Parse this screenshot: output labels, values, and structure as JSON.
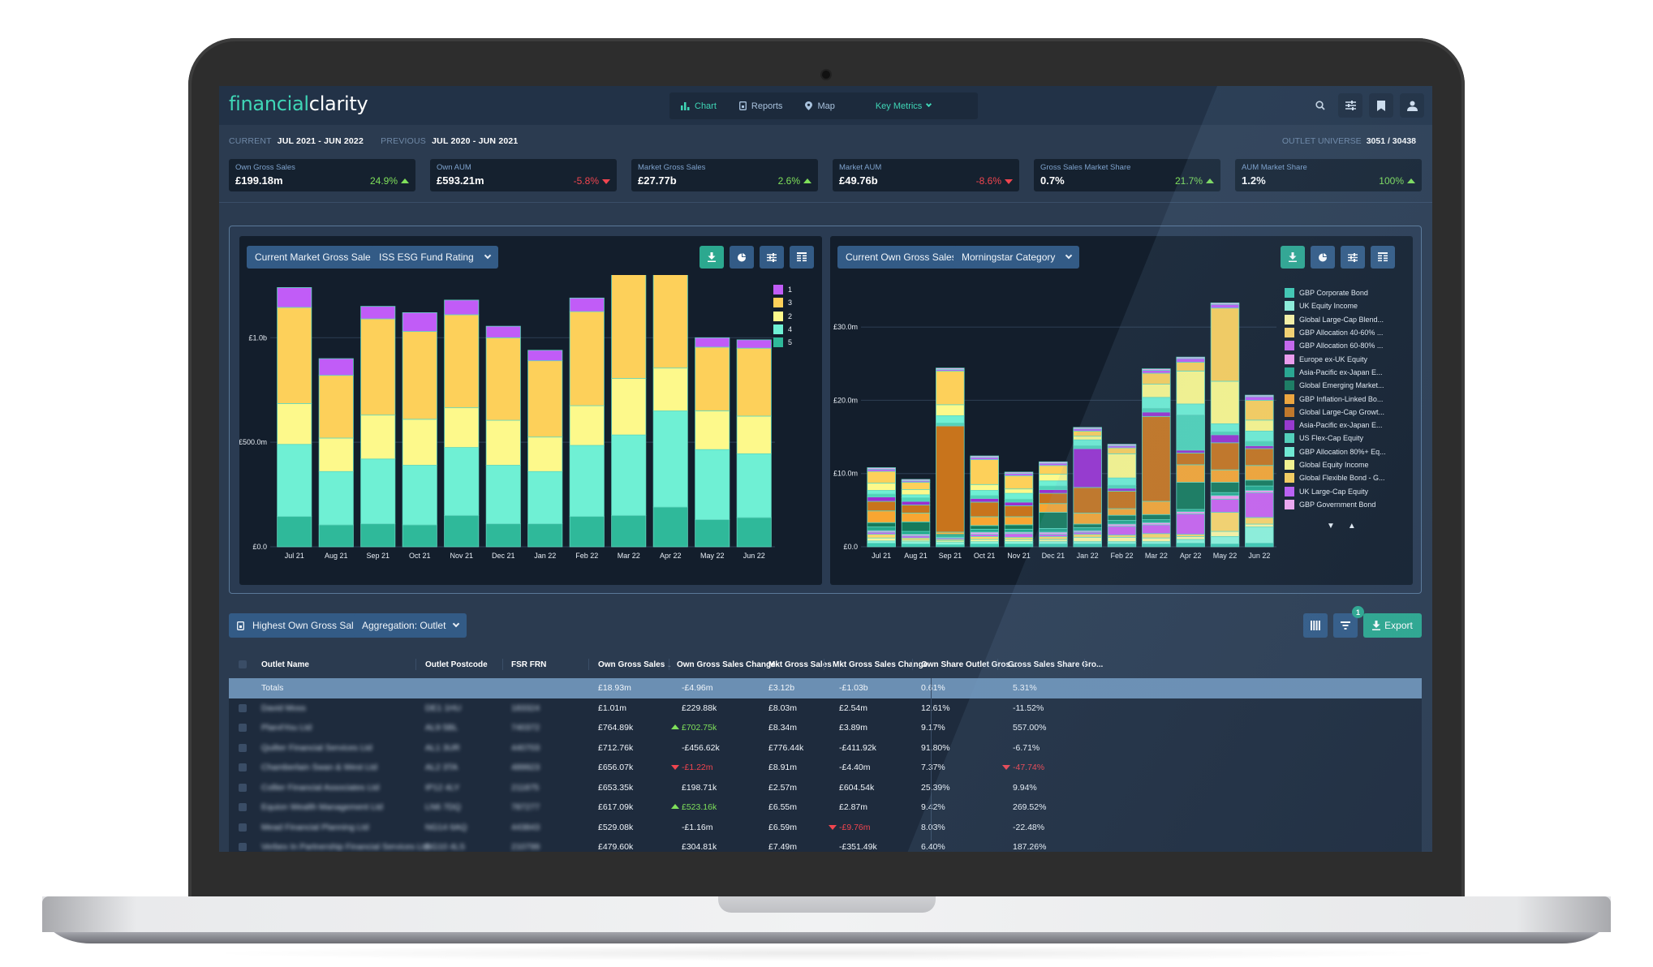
{
  "app": {
    "logo_part1": "financial",
    "logo_part2": "clarity"
  },
  "nav": {
    "items": [
      {
        "label": "Chart",
        "icon": "bar-chart-icon",
        "active": true
      },
      {
        "label": "Reports",
        "icon": "document-icon",
        "active": false
      },
      {
        "label": "Map",
        "icon": "map-pin-icon",
        "active": false
      }
    ],
    "key_metrics_label": "Key Metrics",
    "right_icons": [
      "search-icon",
      "sliders-icon",
      "bookmark-icon",
      "user-icon"
    ]
  },
  "period": {
    "current_label": "CURRENT",
    "current_value": "JUL 2021 - JUN 2022",
    "previous_label": "PREVIOUS",
    "previous_value": "JUL 2020 - JUN 2021",
    "universe_label": "OUTLET UNIVERSE",
    "universe_value": "3051 / 30438"
  },
  "kpis": [
    {
      "label": "Own Gross Sales",
      "value": "£199.18m",
      "change": "24.9%",
      "direction": "up"
    },
    {
      "label": "Own AUM",
      "value": "£593.21m",
      "change": "-5.8%",
      "direction": "down"
    },
    {
      "label": "Market Gross Sales",
      "value": "£27.77b",
      "change": "2.6%",
      "direction": "up"
    },
    {
      "label": "Market AUM",
      "value": "£49.76b",
      "change": "-8.6%",
      "direction": "down"
    },
    {
      "label": "Gross Sales Market Share",
      "value": "0.7%",
      "change": "21.7%",
      "direction": "up"
    },
    {
      "label": "AUM Market Share",
      "value": "1.2%",
      "change": "100%",
      "direction": "up"
    }
  ],
  "left_panel": {
    "metric_dropdown": "Current Market Gross Sales",
    "group_dropdown": "ISS ESG Fund Rating",
    "tools": [
      "download-icon",
      "pie-chart-icon",
      "sliders-icon",
      "table-icon"
    ]
  },
  "right_panel": {
    "metric_dropdown": "Current Own Gross Sales",
    "group_dropdown": "Morningstar Category",
    "tools": [
      "download-icon",
      "pie-chart-icon",
      "sliders-icon",
      "table-icon"
    ],
    "legend_scroll": {
      "down": "▼",
      "up": "▲"
    }
  },
  "chart_data": [
    {
      "type": "bar",
      "stacked": true,
      "title": "Current Market Gross Sales by ISS ESG Fund Rating",
      "xlabel": "",
      "ylabel": "",
      "ylim": [
        0,
        1300
      ],
      "y_unit": "£m",
      "yticks": [
        {
          "value": 0,
          "label": "£0.0"
        },
        {
          "value": 500,
          "label": "£500.0m"
        },
        {
          "value": 1000,
          "label": "£1.0b"
        }
      ],
      "categories": [
        "Jul 21",
        "Aug 21",
        "Sep 21",
        "Oct 21",
        "Nov 21",
        "Dec 21",
        "Jan 22",
        "Feb 22",
        "Mar 22",
        "Apr 22",
        "May 22",
        "Jun 22"
      ],
      "legend_position": "right",
      "series": [
        {
          "name": "5",
          "color": "#2fb99a",
          "values": [
            145,
            105,
            110,
            105,
            150,
            110,
            110,
            145,
            150,
            190,
            130,
            140
          ]
        },
        {
          "name": "4",
          "color": "#6ff0d4",
          "values": [
            345,
            255,
            310,
            285,
            325,
            280,
            250,
            340,
            385,
            460,
            335,
            305
          ]
        },
        {
          "name": "2",
          "color": "#fdf98b",
          "values": [
            195,
            160,
            210,
            220,
            190,
            215,
            165,
            190,
            270,
            205,
            185,
            180
          ]
        },
        {
          "name": "3",
          "color": "#fdd05a",
          "values": [
            460,
            300,
            460,
            420,
            445,
            395,
            365,
            450,
            600,
            505,
            305,
            325
          ]
        },
        {
          "name": "1",
          "color": "#c15cf7",
          "values": [
            95,
            80,
            60,
            90,
            70,
            55,
            50,
            65,
            75,
            70,
            45,
            40
          ]
        }
      ]
    },
    {
      "type": "bar",
      "stacked": true,
      "title": "Current Own Gross Sales by Morningstar Category",
      "xlabel": "",
      "ylabel": "",
      "ylim": [
        0,
        36
      ],
      "y_unit": "£m",
      "yticks": [
        {
          "value": 0,
          "label": "£0.0"
        },
        {
          "value": 10,
          "label": "£10.0m"
        },
        {
          "value": 20,
          "label": "£20.0m"
        },
        {
          "value": 30,
          "label": "£30.0m"
        }
      ],
      "categories": [
        "Jul 21",
        "Aug 21",
        "Sep 21",
        "Oct 21",
        "Nov 21",
        "Dec 21",
        "Jan 22",
        "Feb 22",
        "Mar 22",
        "Apr 22",
        "May 22",
        "Jun 22"
      ],
      "legend_position": "right",
      "series": [
        {
          "name": "GBP Corporate Bond",
          "color": "#3ecbb3",
          "values": [
            0.5,
            0.4,
            0.3,
            0.4,
            0.4,
            0.4,
            0.4,
            0.4,
            0.4,
            0.5,
            0.4,
            0.5
          ]
        },
        {
          "name": "UK Equity Income",
          "color": "#8ff5dc",
          "values": [
            0.3,
            0.3,
            0.3,
            0.3,
            0.3,
            0.3,
            0.3,
            0.3,
            0.3,
            0.5,
            1.0,
            2.2
          ]
        },
        {
          "name": "Global Large-Cap Blend...",
          "color": "#fff7a3",
          "values": [
            0.4,
            0.2,
            0.2,
            0.3,
            0.3,
            0.3,
            0.6,
            0.6,
            0.5,
            0.4,
            0.7,
            0.4
          ]
        },
        {
          "name": "GBP Allocation 40-60% ...",
          "color": "#fdd66a",
          "values": [
            0.5,
            0.3,
            0.2,
            0.4,
            0.3,
            0.4,
            0.4,
            0.3,
            0.6,
            0.3,
            2.6,
            0.9
          ]
        },
        {
          "name": "GBP Allocation 60-80% ...",
          "color": "#cc63f0",
          "values": [
            0.3,
            0.3,
            0.2,
            0.3,
            0.5,
            0.3,
            0.3,
            1.2,
            1.2,
            2.8,
            1.8,
            3.4
          ]
        },
        {
          "name": "Europe ex-UK Equity",
          "color": "#f59cf1",
          "values": [
            0.2,
            0.2,
            0.1,
            0.3,
            0.2,
            0.3,
            0.2,
            0.3,
            0.3,
            0.3,
            0.5,
            0.3
          ]
        },
        {
          "name": "Asia-Pacific ex-Japan E...",
          "color": "#22a88c",
          "values": [
            0.5,
            0.4,
            0.2,
            0.4,
            0.4,
            0.5,
            0.4,
            0.5,
            0.4,
            0.3,
            0.4,
            0.6
          ]
        },
        {
          "name": "Global Emerging Market...",
          "color": "#157a5b",
          "values": [
            0.6,
            1.3,
            0.2,
            0.5,
            0.6,
            2.2,
            0.5,
            0.7,
            0.7,
            3.7,
            1.4,
            0.8
          ]
        },
        {
          "name": "GBP Inflation-Linked Bo...",
          "color": "#f8a632",
          "values": [
            1.6,
            1.2,
            0.3,
            1.2,
            1.1,
            1.2,
            1.5,
            0.9,
            1.8,
            2.4,
            1.7,
            2.0
          ]
        },
        {
          "name": "Global Large-Cap Growt...",
          "color": "#c8741c",
          "values": [
            1.3,
            1.1,
            14.5,
            2.0,
            1.5,
            1.4,
            3.5,
            2.4,
            11.6,
            1.6,
            3.7,
            2.3
          ]
        },
        {
          "name": "Asia-Pacific ex-Japan E...",
          "color": "#9a2fd0",
          "values": [
            0.6,
            0.5,
            0.1,
            0.5,
            0.5,
            0.5,
            5.3,
            0.4,
            0.6,
            0.4,
            1.1,
            0.4
          ]
        },
        {
          "name": "US Flex-Cap Equity",
          "color": "#4fd4b8",
          "values": [
            0.4,
            0.5,
            0.3,
            0.4,
            0.4,
            0.5,
            0.4,
            0.4,
            0.5,
            4.8,
            0.4,
            0.6
          ]
        },
        {
          "name": "GBP Allocation 80%+ Eq...",
          "color": "#6ff0d4",
          "values": [
            0.5,
            0.4,
            1.0,
            0.7,
            0.8,
            0.7,
            0.8,
            1.0,
            1.5,
            1.5,
            1.1,
            1.4
          ]
        },
        {
          "name": "Global Equity Income",
          "color": "#fdf98b",
          "values": [
            1.0,
            0.7,
            1.5,
            0.8,
            0.6,
            0.9,
            0.5,
            3.3,
            1.8,
            4.5,
            5.8,
            1.5
          ]
        },
        {
          "name": "Global Flexible Bond - G...",
          "color": "#fdd05a",
          "values": [
            1.6,
            1.0,
            4.6,
            3.4,
            1.8,
            1.2,
            0.7,
            0.8,
            1.5,
            1.2,
            10.0,
            2.7
          ]
        },
        {
          "name": "UK Large-Cap Equity",
          "color": "#c15cf7",
          "values": [
            0.3,
            0.2,
            0.2,
            0.3,
            0.3,
            0.3,
            0.3,
            0.3,
            0.4,
            0.5,
            0.5,
            0.5
          ]
        },
        {
          "name": "GBP Government Bond",
          "color": "#f5a8f3",
          "values": [
            0.2,
            0.2,
            0.2,
            0.2,
            0.2,
            0.2,
            0.2,
            0.2,
            0.2,
            0.2,
            0.2,
            0.2
          ]
        }
      ]
    }
  ],
  "table_toolbar": {
    "report_dropdown": "Highest Own Gross Sales",
    "aggregation_dropdown": "Aggregation: Outlet",
    "filter_count": "1",
    "export_label": "Export"
  },
  "table": {
    "columns": [
      {
        "label": "Outlet Name"
      },
      {
        "label": "Outlet Postcode"
      },
      {
        "label": "FSR FRN"
      },
      {
        "label": "Own Gross Sales",
        "sorted": "desc"
      },
      {
        "label": "Own Gross Sales Change"
      },
      {
        "label": "Mkt Gross Sales"
      },
      {
        "label": "Mkt Gross Sales Change"
      },
      {
        "label": "Own Share Outlet Gros..."
      },
      {
        "label": "Gross Sales Share Gro..."
      }
    ],
    "totals": {
      "label": "Totals",
      "own_gross_sales": "£18.93m",
      "own_gross_sales_change": "-£4.96m",
      "mkt_gross_sales": "£3.12b",
      "mkt_gross_sales_change": "-£1.03b",
      "own_share": "0.61%",
      "share_growth": "5.31%"
    },
    "rows": [
      {
        "name": "David Moss",
        "postcode": "DE1 1HU",
        "frn": "183324",
        "own": "£1.01m",
        "own_chg": "£229.88k",
        "own_chg_dir": "",
        "mkt": "£8.03m",
        "mkt_chg": "£2.54m",
        "mkt_chg_dir": "",
        "share": "12.61%",
        "growth": "-11.52%",
        "growth_dir": ""
      },
      {
        "name": "Plan4You Ltd",
        "postcode": "AL9 5BL",
        "frn": "740372",
        "own": "£764.89k",
        "own_chg": "£702.75k",
        "own_chg_dir": "up",
        "mkt": "£8.34m",
        "mkt_chg": "£3.89m",
        "mkt_chg_dir": "",
        "share": "9.17%",
        "growth": "557.00%",
        "growth_dir": ""
      },
      {
        "name": "Quilter Financial Services Ltd",
        "postcode": "AL1 3UR",
        "frn": "440703",
        "own": "£712.76k",
        "own_chg": "-£456.62k",
        "own_chg_dir": "",
        "mkt": "£776.44k",
        "mkt_chg": "-£411.92k",
        "mkt_chg_dir": "",
        "share": "91.80%",
        "growth": "-6.71%",
        "growth_dir": ""
      },
      {
        "name": "Chamberlain Swan & West Ltd",
        "postcode": "AL2 3TA",
        "frn": "489923",
        "own": "£656.07k",
        "own_chg": "-£1.22m",
        "own_chg_dir": "down",
        "mkt": "£8.91m",
        "mkt_chg": "-£4.40m",
        "mkt_chg_dir": "",
        "share": "7.37%",
        "growth": "-47.74%",
        "growth_dir": "down"
      },
      {
        "name": "Collier Financial Associates Ltd",
        "postcode": "IP12 4LY",
        "frn": "211875",
        "own": "£653.35k",
        "own_chg": "£198.71k",
        "own_chg_dir": "",
        "mkt": "£2.57m",
        "mkt_chg": "£604.54k",
        "mkt_chg_dir": "",
        "share": "25.39%",
        "growth": "9.94%",
        "growth_dir": ""
      },
      {
        "name": "Equion Wealth Management Ltd",
        "postcode": "LN6 7DQ",
        "frn": "787277",
        "own": "£617.09k",
        "own_chg": "£523.16k",
        "own_chg_dir": "up",
        "mkt": "£6.55m",
        "mkt_chg": "£2.87m",
        "mkt_chg_dir": "",
        "share": "9.42%",
        "growth": "269.52%",
        "growth_dir": ""
      },
      {
        "name": "Mead Financial Planning Ltd",
        "postcode": "NG14 6AQ",
        "frn": "443843",
        "own": "£529.08k",
        "own_chg": "-£1.16m",
        "own_chg_dir": "",
        "mkt": "£6.59m",
        "mkt_chg": "-£9.76m",
        "mkt_chg_dir": "down",
        "share": "8.03%",
        "growth": "-22.48%",
        "growth_dir": ""
      },
      {
        "name": "Verbex In Partnership Financial Services Ltd",
        "postcode": "NG10 4LS",
        "frn": "210799",
        "own": "£479.60k",
        "own_chg": "£304.81k",
        "own_chg_dir": "",
        "mkt": "£7.49m",
        "mkt_chg": "-£351.49k",
        "mkt_chg_dir": "",
        "share": "6.40%",
        "growth": "187.26%",
        "growth_dir": ""
      }
    ]
  }
}
